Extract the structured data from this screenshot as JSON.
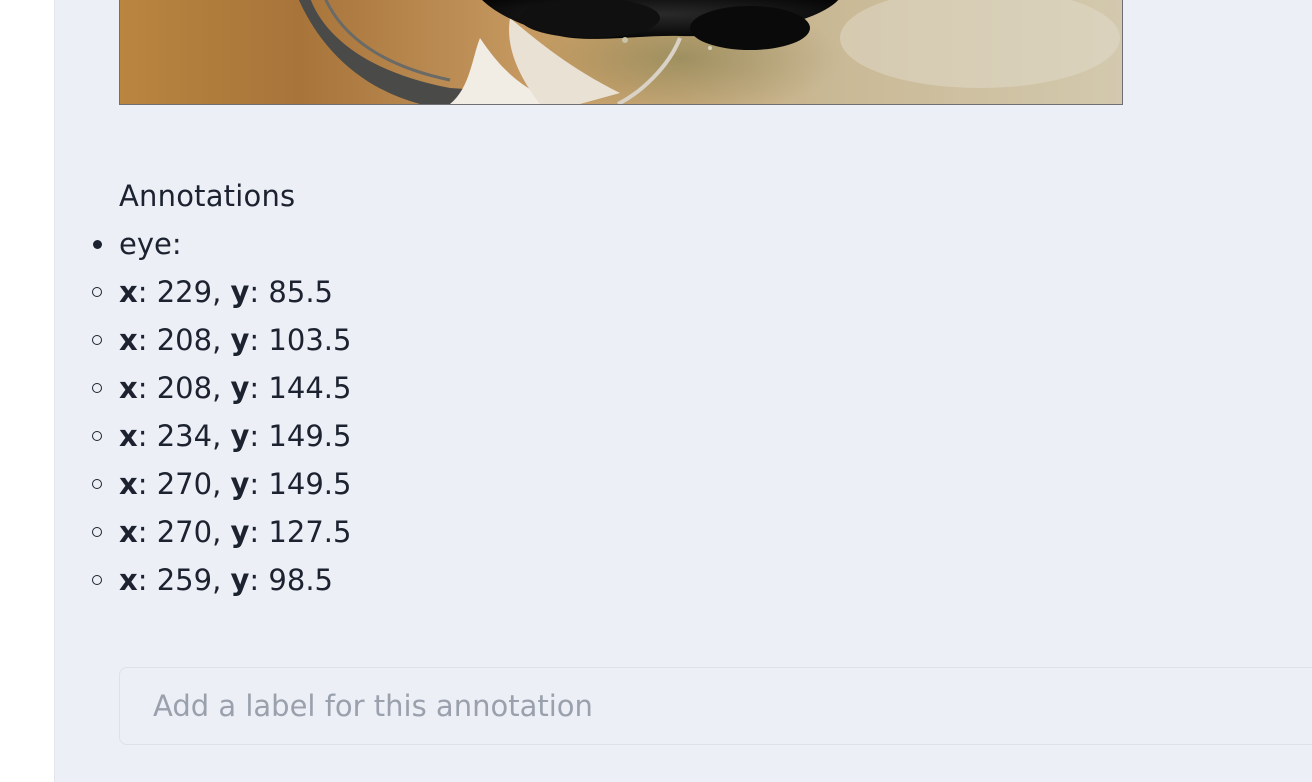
{
  "annotations": {
    "title": "Annotations",
    "label_name": "eye:",
    "points": [
      {
        "x_key": "x",
        "x_value": "229",
        "y_key": "y",
        "y_value": "85.5"
      },
      {
        "x_key": "x",
        "x_value": "208",
        "y_key": "y",
        "y_value": "103.5"
      },
      {
        "x_key": "x",
        "x_value": "208",
        "y_key": "y",
        "y_value": "144.5"
      },
      {
        "x_key": "x",
        "x_value": "234",
        "y_key": "y",
        "y_value": "149.5"
      },
      {
        "x_key": "x",
        "x_value": "270",
        "y_key": "y",
        "y_value": "149.5"
      },
      {
        "x_key": "x",
        "x_value": "270",
        "y_key": "y",
        "y_value": "127.5"
      },
      {
        "x_key": "x",
        "x_value": "259",
        "y_key": "y",
        "y_value": "98.5"
      }
    ]
  },
  "label_input": {
    "placeholder": "Add a label for this annotation",
    "value": ""
  },
  "colors": {
    "panel_background": "#eceff5",
    "text": "#1c2230",
    "placeholder": "#9aa1ad"
  }
}
